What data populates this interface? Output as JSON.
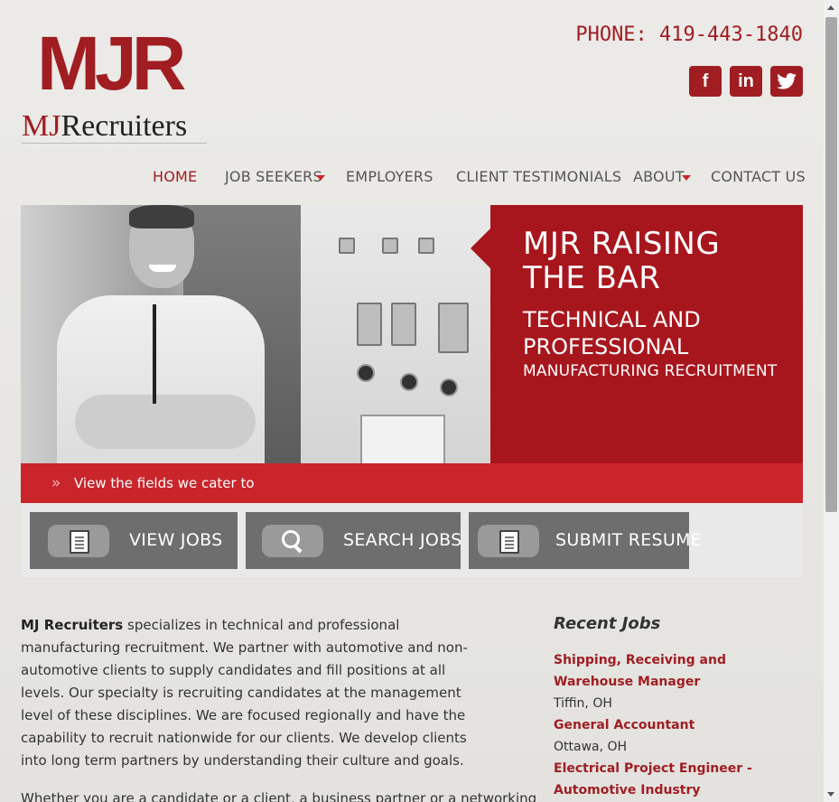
{
  "logo": {
    "mark": "MJR",
    "text_mj": "MJ",
    "text_rest": "Recruiters"
  },
  "phone": "PHONE: 419-443-1840",
  "social": {
    "facebook": "f",
    "linkedin": "in",
    "twitter": "t"
  },
  "nav": {
    "items": [
      {
        "label": "HOME"
      },
      {
        "label": "JOB SEEKERS"
      },
      {
        "label": "EMPLOYERS"
      },
      {
        "label": "CLIENT TESTIMONIALS"
      },
      {
        "label": "ABOUT"
      },
      {
        "label": "CONTACT US"
      }
    ]
  },
  "hero": {
    "title_line1": "MJR RAISING",
    "title_line2": "THE BAR",
    "sub_line1": "TECHNICAL AND",
    "sub_line2": "PROFESSIONAL",
    "sub2": "MANUFACTURING RECRUITMENT"
  },
  "cater": {
    "icon": "double-chevron-right-icon",
    "text": "View the fields we cater to"
  },
  "buttons": {
    "view_jobs": "VIEW JOBS",
    "search_jobs": "SEARCH JOBS",
    "submit_resume": "SUBMIT RESUME"
  },
  "intro": {
    "company": "MJ Recruiters",
    "body": " specializes in technical and professional manufacturing recruitment. We partner with automotive and non-automotive clients to supply candidates and fill positions at all levels. Our specialty is recruiting candidates at the management level of these disciplines. We are focused regionally and have the capability to recruit nationwide for our clients. We develop clients into long term partners by understanding their culture and goals.",
    "body2": "Whether you are a candidate or a client, a business partner or a networking"
  },
  "recent_jobs": {
    "title": "Recent Jobs",
    "items": [
      {
        "title": "Shipping, Receiving and Warehouse Manager",
        "location": "Tiffin, OH"
      },
      {
        "title": "General Accountant",
        "location": "Ottawa, OH"
      },
      {
        "title": "Electrical Project Engineer - Automotive Industry",
        "location": ""
      }
    ]
  },
  "colors": {
    "brand": "#a01d22",
    "accent": "#c9252b",
    "button": "#6e6e6e"
  }
}
